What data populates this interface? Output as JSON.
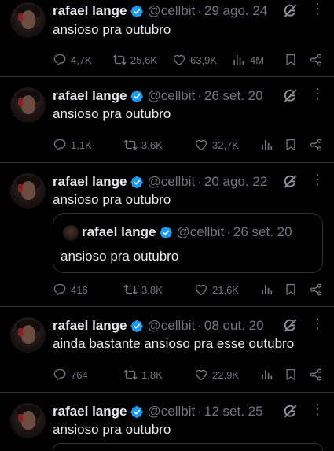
{
  "tweets": [
    {
      "name": "rafael lange",
      "handle": "@cellbit",
      "dot": "·",
      "date": "29 ago. 24",
      "text": "ansioso pra outubro",
      "replies": "4,7K",
      "reposts": "25,6K",
      "likes": "63,9K",
      "views": "4M"
    },
    {
      "name": "rafael lange",
      "handle": "@cellbit",
      "dot": "·",
      "date": "26 set. 20",
      "text": "ansioso pra outubro",
      "replies": "1,1K",
      "reposts": "3,6K",
      "likes": "32,7K",
      "views": ""
    },
    {
      "name": "rafael lange",
      "handle": "@cellbit",
      "dot": "·",
      "date": "20 ago. 22",
      "text": "ansioso pra outubro",
      "quote": {
        "name": "rafael lange",
        "handle": "@cellbit",
        "dot": "·",
        "date": "26 set. 20",
        "text": "ansioso pra outubro"
      },
      "replies": "416",
      "reposts": "3,8K",
      "likes": "21,6K",
      "views": ""
    },
    {
      "name": "rafael lange",
      "handle": "@cellbit",
      "dot": "·",
      "date": "08 out. 20",
      "text": "ainda bastante ansioso pra esse outubro",
      "replies": "764",
      "reposts": "1,8K",
      "likes": "22,9K",
      "views": ""
    },
    {
      "name": "rafael lange",
      "handle": "@cellbit",
      "dot": "·",
      "date": "12 set. 25",
      "text": "ansioso pra outubro"
    }
  ],
  "icons": {
    "verified": "verified-badge-icon",
    "grok": "grok-icon",
    "more": "more-icon",
    "reply": "reply-icon",
    "repost": "repost-icon",
    "like": "like-icon",
    "views": "views-icon",
    "bookmark": "bookmark-icon",
    "share": "share-icon"
  },
  "colors": {
    "background": "#000000",
    "text": "#e7e9ea",
    "muted": "#71767b",
    "verified": "#1d9bf0",
    "border": "#2f3336"
  }
}
